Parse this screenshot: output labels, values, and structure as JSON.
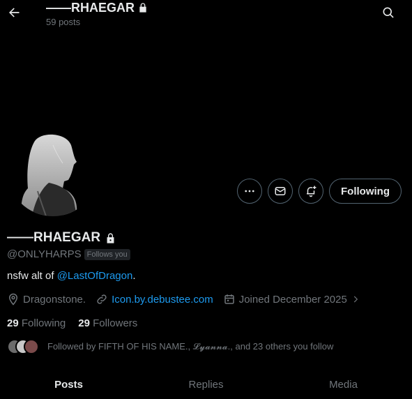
{
  "header": {
    "title": "RHAEGAR",
    "title_prefix_dash": "——",
    "post_count": "59 posts"
  },
  "profile": {
    "display_name": "RHAEGAR",
    "display_name_prefix_dash": "——",
    "handle": "@ONLYHARPS",
    "follows_you": "Follows you",
    "bio_text": "nsfw alt of ",
    "bio_link": "@LastOfDragon",
    "bio_suffix": ".",
    "location": "Dragonstone.",
    "website": "Icon.by.debustee.com",
    "joined": "Joined December 2025",
    "following_count": "29",
    "following_label": "Following",
    "followers_count": "29",
    "followers_label": "Followers",
    "followed_by": "Followed by FIFTH OF HIS NAME., 𝓛𝔂𝓪𝓷𝓷𝓪., and 23 others you follow"
  },
  "actions": {
    "following_button": "Following"
  },
  "tabs": [
    "Posts",
    "Replies",
    "Media"
  ],
  "colors": {
    "background": "#000000",
    "link": "#1d9bf0",
    "muted": "#71767b",
    "text": "#e7e9ea"
  }
}
